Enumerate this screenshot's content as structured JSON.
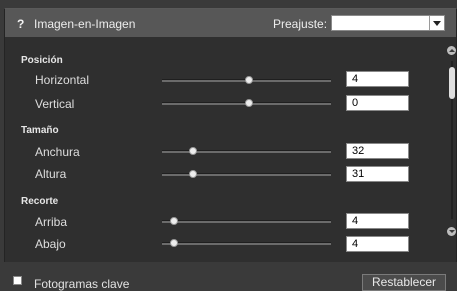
{
  "header": {
    "help_icon": "?",
    "title": "Imagen-en-Imagen",
    "preset_label": "Preajuste:",
    "preset_value": ""
  },
  "sections": {
    "position": {
      "title": "Posición",
      "horizontal": {
        "label": "Horizontal",
        "value": "4"
      },
      "vertical": {
        "label": "Vertical",
        "value": "0"
      }
    },
    "size": {
      "title": "Tamaño",
      "width": {
        "label": "Anchura",
        "value": "32"
      },
      "height": {
        "label": "Altura",
        "value": "31"
      }
    },
    "crop": {
      "title": "Recorte",
      "top": {
        "label": "Arriba",
        "value": "4"
      },
      "bottom": {
        "label": "Abajo",
        "value": "4"
      }
    }
  },
  "footer": {
    "keyframes_label": "Fotogramas clave",
    "reset_label": "Restablecer"
  },
  "icons": {
    "help": "help-icon",
    "dropdown": "chevron-down-icon",
    "scroll_up": "scroll-up-icon",
    "scroll_down": "scroll-down-icon"
  },
  "colors": {
    "panel_bg": "#2f2f2f",
    "header_bg": "#575757",
    "text": "#e6e6e6"
  }
}
